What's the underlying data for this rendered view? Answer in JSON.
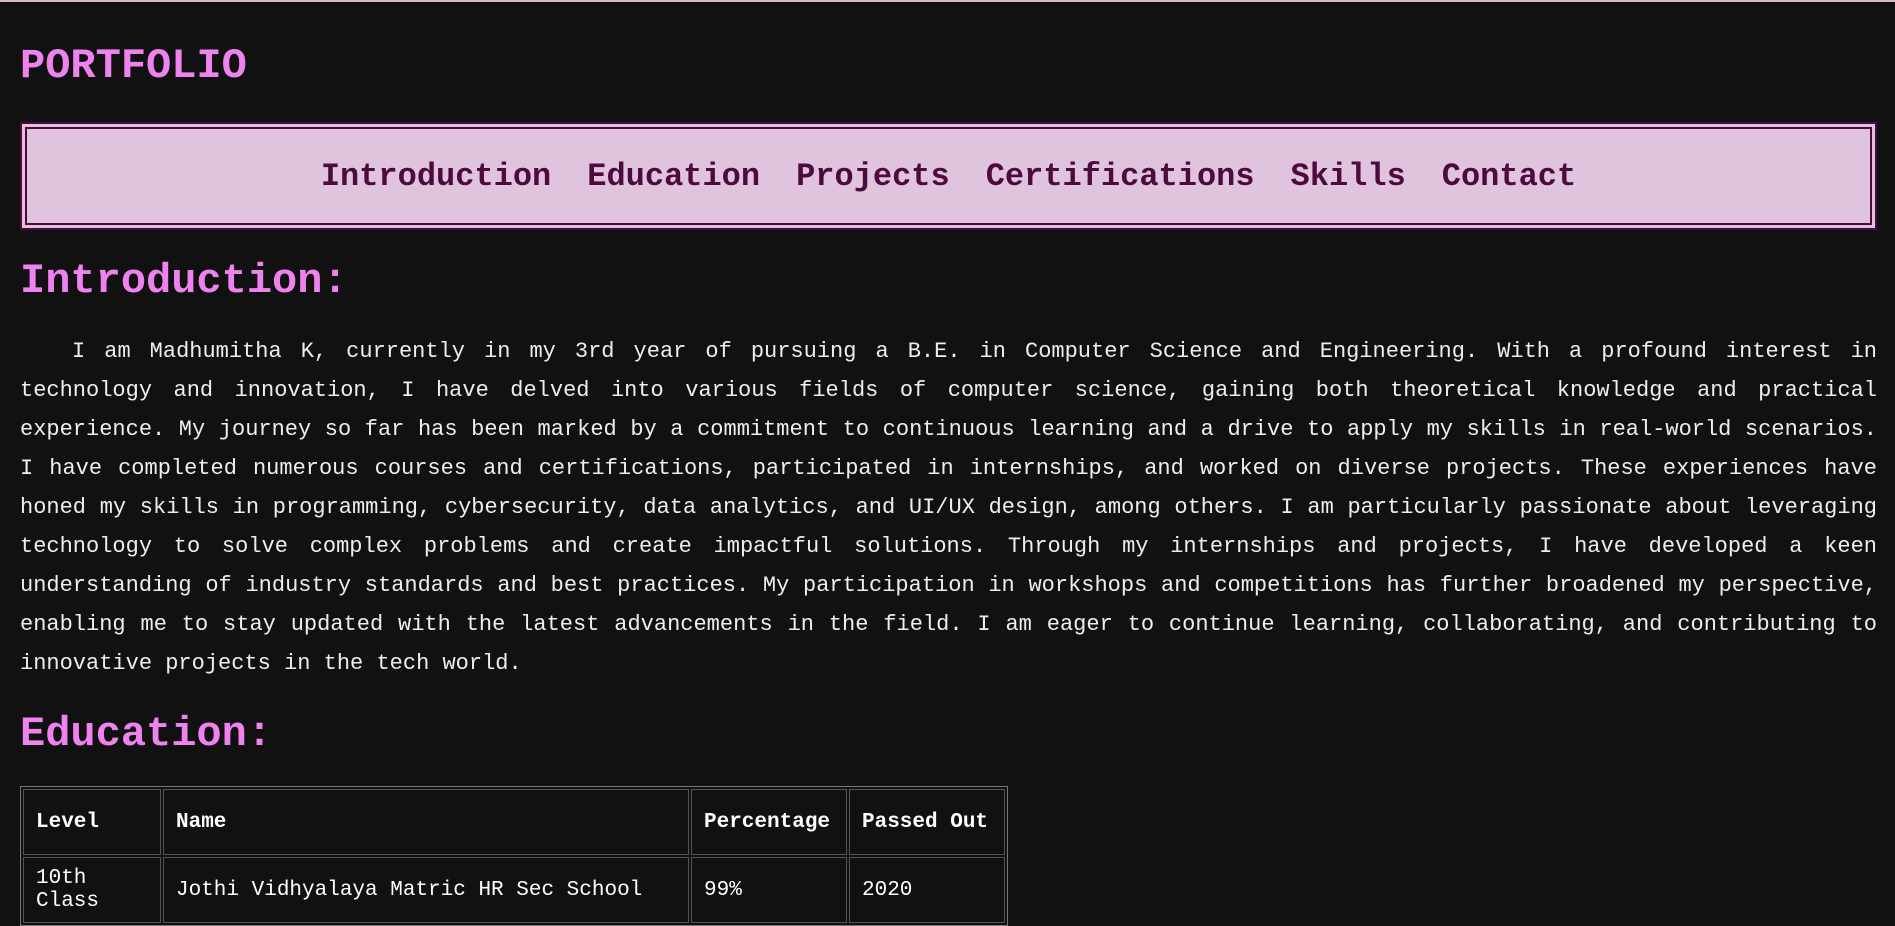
{
  "header": {
    "title": "PORTFOLIO"
  },
  "nav": {
    "items": [
      {
        "label": "Introduction"
      },
      {
        "label": "Education"
      },
      {
        "label": "Projects"
      },
      {
        "label": "Certifications"
      },
      {
        "label": "Skills"
      },
      {
        "label": "Contact"
      }
    ]
  },
  "introduction": {
    "heading": "Introduction:",
    "text": "I am Madhumitha K, currently in my 3rd year of pursuing a B.E. in Computer Science and Engineering. With a profound interest in technology and innovation, I have delved into various fields of computer science, gaining both theoretical knowledge and practical experience. My journey so far has been marked by a commitment to continuous learning and a drive to apply my skills in real-world scenarios. I have completed numerous courses and certifications, participated in internships, and worked on diverse projects. These experiences have honed my skills in programming, cybersecurity, data analytics, and UI/UX design, among others. I am particularly passionate about leveraging technology to solve complex problems and create impactful solutions. Through my internships and projects, I have developed a keen understanding of industry standards and best practices. My participation in workshops and competitions has further broadened my perspective, enabling me to stay updated with the latest advancements in the field. I am eager to continue learning, collaborating, and contributing to innovative projects in the tech world."
  },
  "education": {
    "heading": "Education:",
    "columns": [
      "Level",
      "Name",
      "Percentage",
      "Passed Out"
    ],
    "rows": [
      [
        "10th Class",
        "Jothi Vidhyalaya Matric HR Sec School",
        "99%",
        "2020"
      ]
    ]
  },
  "colors": {
    "background": "#111111",
    "accent": "#ee82ee",
    "nav_bg": "#e0c4de",
    "nav_text": "#4d0a3e"
  }
}
